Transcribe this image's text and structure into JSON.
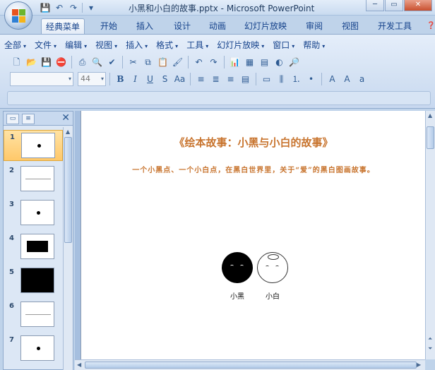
{
  "window": {
    "title": "小黑和小白的故事.pptx - Microsoft PowerPoint"
  },
  "ribbon_tabs": [
    "经典菜单",
    "开始",
    "插入",
    "设计",
    "动画",
    "幻灯片放映",
    "审阅",
    "视图",
    "开发工具"
  ],
  "menus": [
    "全部",
    "文件",
    "编辑",
    "视图",
    "插入",
    "格式",
    "工具",
    "幻灯片放映",
    "窗口",
    "帮助"
  ],
  "font": {
    "name": "",
    "size": "44"
  },
  "slides_pane": {
    "close_glyph": "✕",
    "thumbnails": [
      {
        "num": "1",
        "selected": true
      },
      {
        "num": "2"
      },
      {
        "num": "3"
      },
      {
        "num": "4"
      },
      {
        "num": "5"
      },
      {
        "num": "6"
      },
      {
        "num": "7"
      }
    ]
  },
  "slide": {
    "title": "《绘本故事：小黑与小白的故事》",
    "subtitle": "一个小黑点、一个小白点，在黑白世界里，关于“爱”的黑白图画故事。",
    "characters": [
      {
        "label": "小黑",
        "color": "#000000"
      },
      {
        "label": "小白",
        "color": "#ffffff"
      }
    ]
  },
  "colors": {
    "title_accent": "#c8742e"
  }
}
